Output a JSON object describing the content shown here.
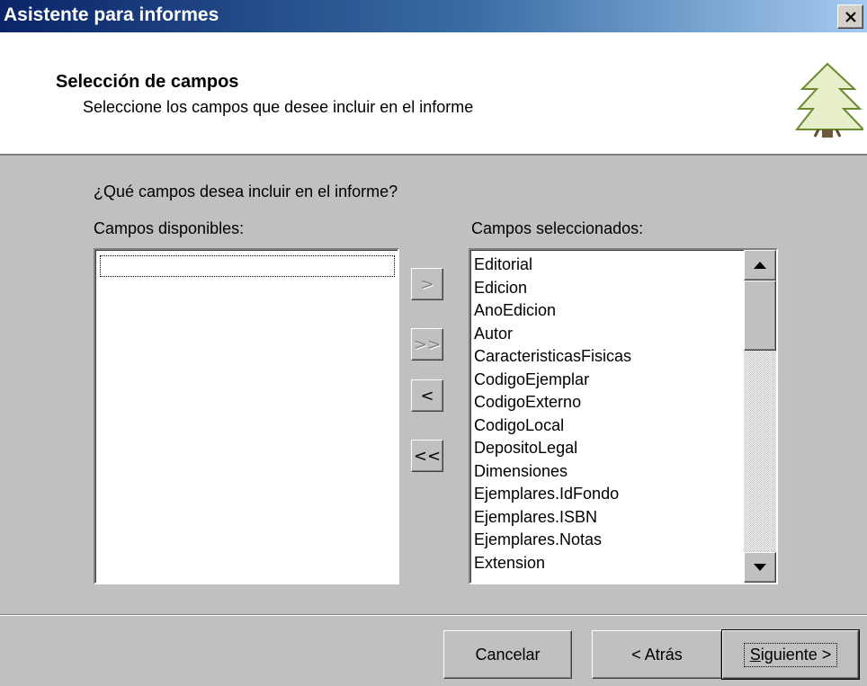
{
  "window": {
    "title": "Asistente para informes"
  },
  "header": {
    "title": "Selección de campos",
    "subtitle": "Seleccione los campos que desee incluir en el informe",
    "icon": "tree-icon"
  },
  "question": "¿Qué campos desea incluir en el informe?",
  "available": {
    "label": "Campos disponibles:",
    "items": []
  },
  "selected": {
    "label": "Campos seleccionados:",
    "items": [
      "Editorial",
      "Edicion",
      "AnoEdicion",
      "Autor",
      "CaracteristicasFisicas",
      "CodigoEjemplar",
      "CodigoExterno",
      "CodigoLocal",
      "DepositoLegal",
      "Dimensiones",
      "Ejemplares.IdFondo",
      "Ejemplares.ISBN",
      "Ejemplares.Notas",
      "Extension"
    ]
  },
  "move_buttons": {
    "add_one": ">",
    "add_all": ">>",
    "remove_one": "<",
    "remove_all": "<<"
  },
  "buttons": {
    "cancel": "Cancelar",
    "back": "< Atrás",
    "next_mnemonic": "S",
    "next_rest": "iguiente >"
  },
  "colors": {
    "titlebar_start": "#0a246a",
    "titlebar_end": "#a6caf0",
    "dialog_bg": "#c0c0c0"
  }
}
